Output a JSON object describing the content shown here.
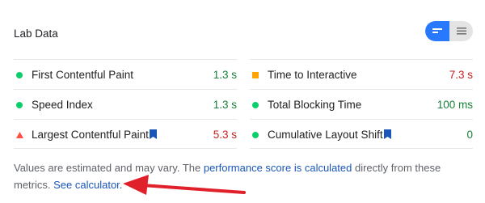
{
  "header": {
    "title": "Lab Data"
  },
  "view_toggle": {
    "options": [
      "summary-view",
      "list-view"
    ],
    "selected": "summary-view"
  },
  "colors": {
    "pass": "#0cce6b",
    "average": "#ffa400",
    "fail": "#ff4e42",
    "pass_text": "#188038",
    "fail_text": "#c5221f",
    "link": "#1a56b8",
    "toggle_active": "#2979ff",
    "arrow": "#e0202a"
  },
  "metrics_left": [
    {
      "label": "First Contentful Paint",
      "value": "1.3 s",
      "status": "pass",
      "bookmark": false
    },
    {
      "label": "Speed Index",
      "value": "1.3 s",
      "status": "pass",
      "bookmark": false
    },
    {
      "label": "Largest Contentful Paint",
      "value": "5.3 s",
      "status": "fail",
      "bookmark": true
    }
  ],
  "metrics_right": [
    {
      "label": "Time to Interactive",
      "value": "7.3 s",
      "status": "average",
      "bookmark": false
    },
    {
      "label": "Total Blocking Time",
      "value": "100 ms",
      "status": "pass",
      "bookmark": false
    },
    {
      "label": "Cumulative Layout Shift",
      "value": "0",
      "status": "pass",
      "bookmark": true
    }
  ],
  "footer": {
    "text_1": "Values are estimated and may vary. The ",
    "link_1": "performance score is calculated",
    "text_2": " directly from these metrics. ",
    "link_2": "See calculator."
  }
}
